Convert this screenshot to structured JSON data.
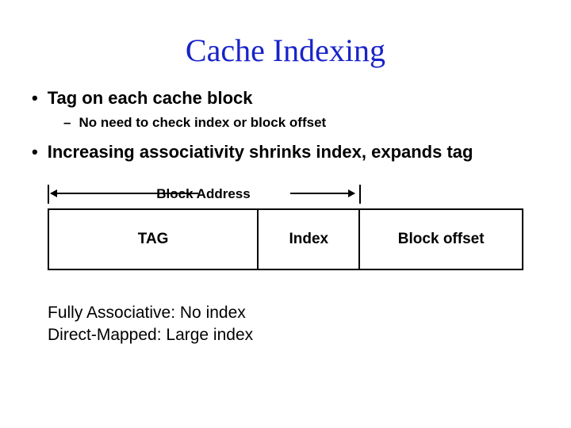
{
  "title": "Cache Indexing",
  "bullets": {
    "b1": "Tag on each cache block",
    "b1_sub": "No need to check index or block offset",
    "b2": "Increasing associativity shrinks index, expands tag"
  },
  "diagram": {
    "block_address": "Block Address",
    "tag": "TAG",
    "index": "Index",
    "offset": "Block offset"
  },
  "notes": {
    "line1": "Fully Associative:  No index",
    "line2": "Direct-Mapped: Large index"
  }
}
